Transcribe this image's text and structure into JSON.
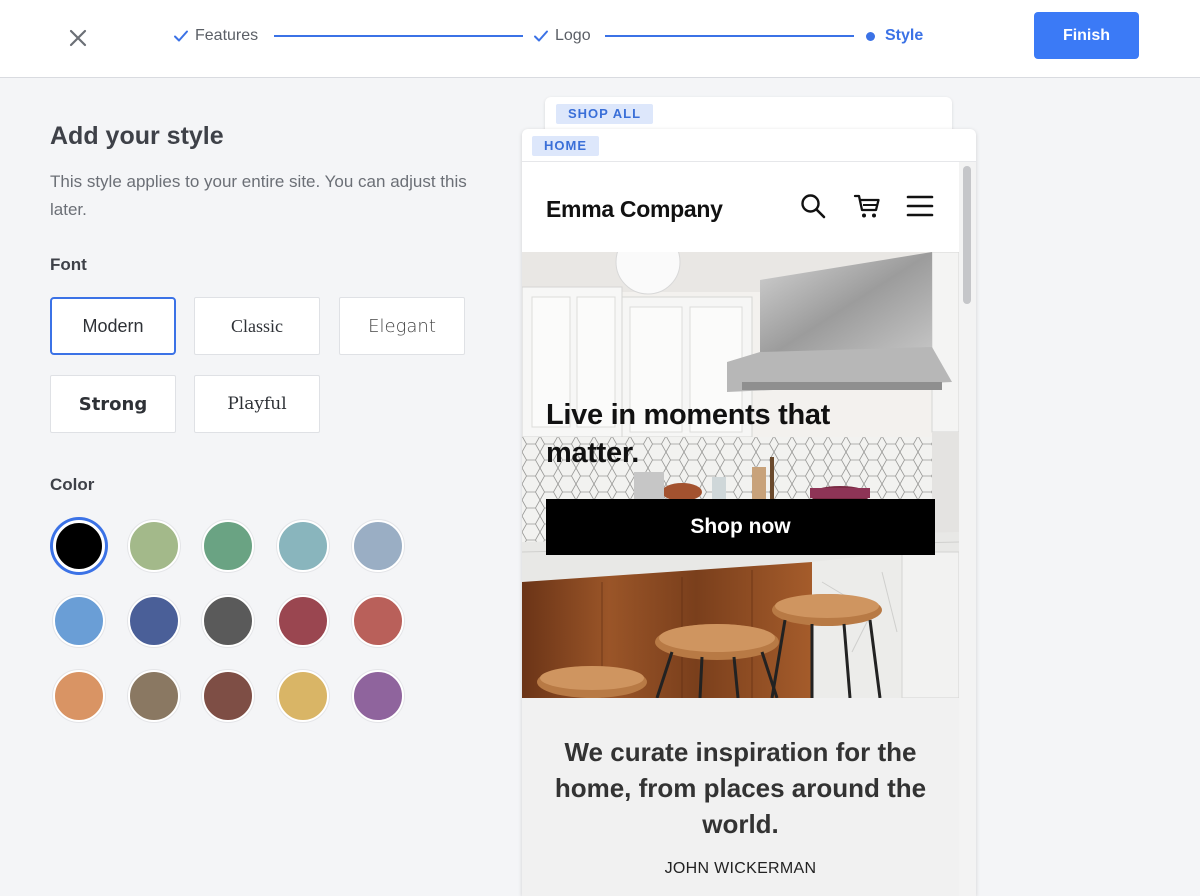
{
  "topbar": {
    "close_icon": "close-icon",
    "steps": [
      {
        "label": "Features",
        "state": "done",
        "icon": "check-icon"
      },
      {
        "label": "Logo",
        "state": "done",
        "icon": "check-icon"
      },
      {
        "label": "Style",
        "state": "current",
        "icon": "dot-icon"
      }
    ],
    "finish_label": "Finish"
  },
  "panel": {
    "title": "Add your style",
    "description": "This style applies to your entire site. You can adjust this later.",
    "font_label": "Font",
    "fonts": [
      "Modern",
      "Classic",
      "Elegant",
      "Strong",
      "Playful"
    ],
    "selected_font": "Modern",
    "color_label": "Color",
    "colors": [
      "#000000",
      "#a3b98a",
      "#6aa383",
      "#89b5bd",
      "#9aaec4",
      "#6a9ed6",
      "#4a5f98",
      "#5a5a5a",
      "#9a4650",
      "#b9605a",
      "#d99464",
      "#8a7862",
      "#7e4e45",
      "#d9b566",
      "#8f649d"
    ],
    "selected_color_index": 0
  },
  "preview": {
    "back_tag": "SHOP ALL",
    "front_tag": "HOME",
    "brand": "Emma Company",
    "header_icons": [
      "search-icon",
      "cart-icon",
      "menu-icon"
    ],
    "hero_title": "Live in moments that matter.",
    "cta": "Shop now",
    "quote": "We curate inspiration for the home, from places around the world.",
    "author": "JOHN WICKERMAN"
  },
  "accent_color": "#3b7af6"
}
